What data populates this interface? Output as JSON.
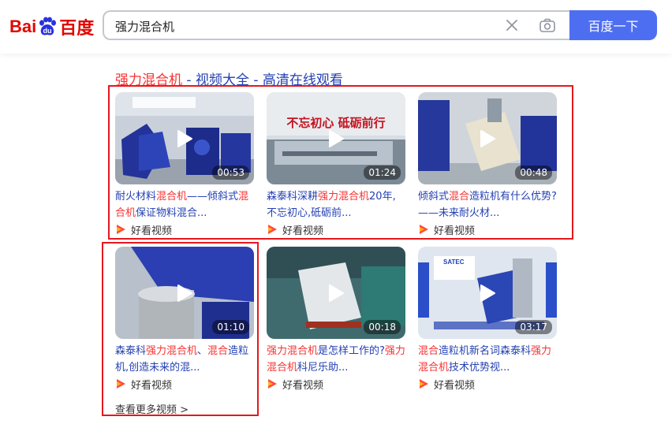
{
  "header": {
    "logo_text_left": "Bai",
    "logo_text_paw": "du",
    "logo_text_right": "百度",
    "search_query": "强力混合机",
    "search_button_label": "百度一下"
  },
  "result": {
    "title_keyword": "强力混合机",
    "title_rest": " - 视频大全 - 高清在线观看"
  },
  "videos": [
    {
      "duration": "00:53",
      "title_parts": [
        "耐火材料",
        "混合机",
        "——倾斜式",
        "混合机",
        "保证物料混合..."
      ],
      "source": "好看视频"
    },
    {
      "duration": "01:24",
      "thumb_text": "不忘初心 砥砺前行",
      "title_parts": [
        "森泰科深耕",
        "强力混合机",
        "20年,不忘初心,砥砺前..."
      ],
      "source": "好看视频"
    },
    {
      "duration": "00:48",
      "title_parts": [
        "倾斜式",
        "混合",
        "造粒机有什么优势?——未来耐火材..."
      ],
      "source": "好看视频"
    },
    {
      "duration": "01:10",
      "title_parts": [
        "森泰科",
        "强力混合机",
        "、",
        "混合",
        "造粒机,创造未来的混..."
      ],
      "source": "好看视频"
    },
    {
      "duration": "00:18",
      "title_parts": [
        "强力混合机",
        "是怎样工作的?",
        "强力混合机",
        "科尼乐助..."
      ],
      "source": "好看视频"
    },
    {
      "duration": "03:17",
      "thumb_text": "SATEC",
      "title_parts": [
        "混合",
        "造粒机新名词森泰科",
        "强力混合机",
        "技术优势视..."
      ],
      "source": "好看视频"
    }
  ],
  "more_link": "查看更多视频 >",
  "colors": {
    "accent": "#4e6ef2",
    "link": "#2440b3",
    "highlight": "#f73131",
    "annotation_box": "#e3191e"
  }
}
